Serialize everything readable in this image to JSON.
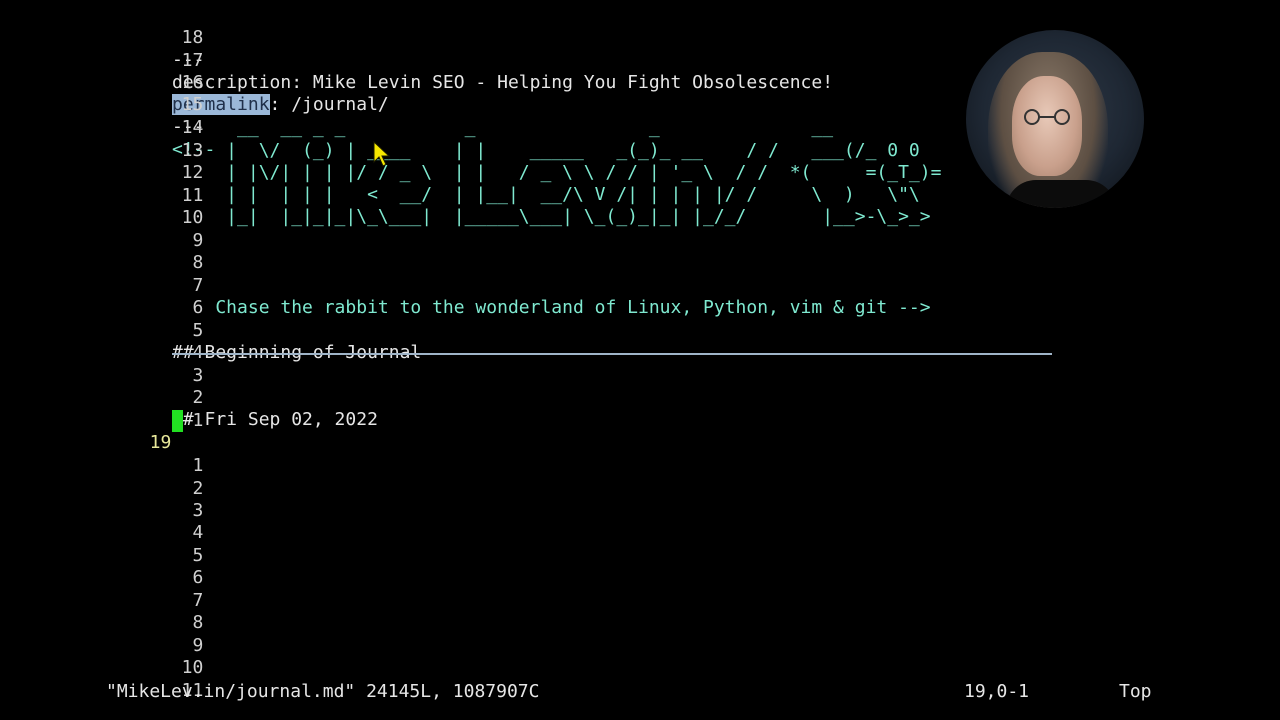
{
  "editor": {
    "lines": {
      "l18": {
        "num": "18",
        "text": "---"
      },
      "l17": {
        "num": "17",
        "text": "description: Mike Levin SEO - Helping You Fight Obsolescence!"
      },
      "l16": {
        "num": "16",
        "text_selected": "permalink",
        "text_rest": ": /journal/"
      },
      "l15": {
        "num": "15",
        "text": "---"
      },
      "l14": {
        "num": "14",
        "text": "<!--"
      },
      "l13": {
        "num": "13"
      },
      "l12": {
        "num": "12"
      },
      "l11": {
        "num": "11"
      },
      "l10": {
        "num": "10"
      },
      "l9": {
        "num": "9"
      },
      "l8": {
        "num": "8"
      },
      "l7": {
        "num": "7",
        "text": "    Chase the rabbit to the wonderland of Linux, Python, vim & git -->"
      },
      "l6": {
        "num": "6"
      },
      "l5": {
        "num": "5",
        "text": "## Beginning of Journal"
      },
      "l4": {
        "num": "4"
      },
      "l3": {
        "num": "3"
      },
      "l2": {
        "num": "2",
        "text": "## Fri Sep 02, 2022"
      },
      "l1": {
        "num": "1"
      },
      "cur": {
        "num": "19"
      },
      "b1": {
        "num": "1"
      },
      "b2": {
        "num": "2"
      },
      "b3": {
        "num": "3"
      },
      "b4": {
        "num": "4"
      },
      "b5": {
        "num": "5"
      },
      "b6": {
        "num": "6"
      },
      "b7": {
        "num": "7"
      },
      "b8": {
        "num": "8"
      },
      "b9": {
        "num": "9"
      },
      "b10": {
        "num": "10"
      },
      "b11": {
        "num": "11"
      }
    },
    "ascii_art": "                                                                                /)\n      __  __ _ _           _                _              __             /)\\_ _//\n     |  \\/  (_) | ____    | |    _____   _(_)_ __    / /   ___(/_ 0 0\n     | |\\/| | | |/ / _ \\  | |   / _ \\ \\ / / | '_ \\  / /  *(     =(_T_)=\n     | |  | | |   <  __/  | |__|  __/\\ V /| | | | |/ /     \\  )   \\\"\\\n     |_|  |_|_|_|\\_\\___|  |_____\\___| \\_(_)_|_| |_/_/       |__>-\\_>_>"
  },
  "statusbar": {
    "file_info": "\"MikeLev.in/journal.md\" 24145L, 1087907C",
    "position": "19,0-1",
    "scroll": "Top"
  },
  "colors": {
    "background": "#000000",
    "text": "#e6e6e6",
    "cyan_comment": "#7fe9d0",
    "selection": "#9bb8d8",
    "cursor": "#22e022",
    "current_line_number": "#e8e89a",
    "mouse_pointer": "#f5e600"
  },
  "icons": {
    "mouse": "mouse-pointer-icon"
  }
}
